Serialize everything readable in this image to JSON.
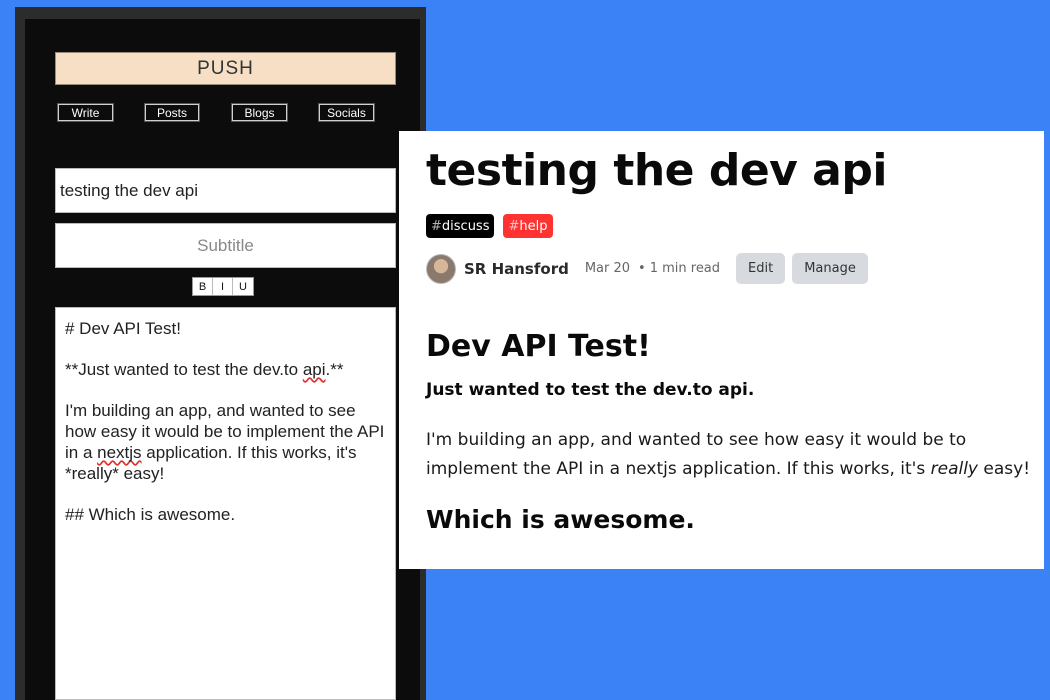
{
  "editor_app": {
    "brand": "PUSH",
    "nav": [
      "Write",
      "Posts",
      "Blogs",
      "Socials"
    ],
    "title_value": "testing the dev api",
    "subtitle_placeholder": "Subtitle",
    "format_buttons": [
      "B",
      "I",
      "U"
    ],
    "markdown": {
      "line1": "# Dev API Test!",
      "line2_pre": "**Just wanted to test the dev.to ",
      "line2_sq": "api",
      "line2_post": ".**",
      "line3_pre": "I'm building an app, and wanted to see how easy it would be to implement the API in a ",
      "line3_sq": "nextjs",
      "line3_post": " application. If this works, it's *really* easy!",
      "line4": "## Which is awesome."
    }
  },
  "preview": {
    "title": "testing the dev api",
    "tags": [
      {
        "hash": "#",
        "name": "discuss"
      },
      {
        "hash": "#",
        "name": "help"
      }
    ],
    "author": "SR Hansford",
    "date": "Mar 20",
    "separator": "•",
    "read_time": "1 min read",
    "edit_label": "Edit",
    "manage_label": "Manage",
    "body": {
      "h1": "Dev API Test!",
      "strong": "Just wanted to test the dev.to api.",
      "p_pre": "I'm building an app, and wanted to see how easy it would be to implement the API in a nextjs application. If this works, it's ",
      "p_em": "really",
      "p_post": " easy!",
      "h2": "Which is awesome."
    }
  },
  "colors": {
    "background": "#3b82f6",
    "push_button": "#f6dfc4",
    "tag_discuss": "#000000",
    "tag_help": "#ff3232"
  }
}
